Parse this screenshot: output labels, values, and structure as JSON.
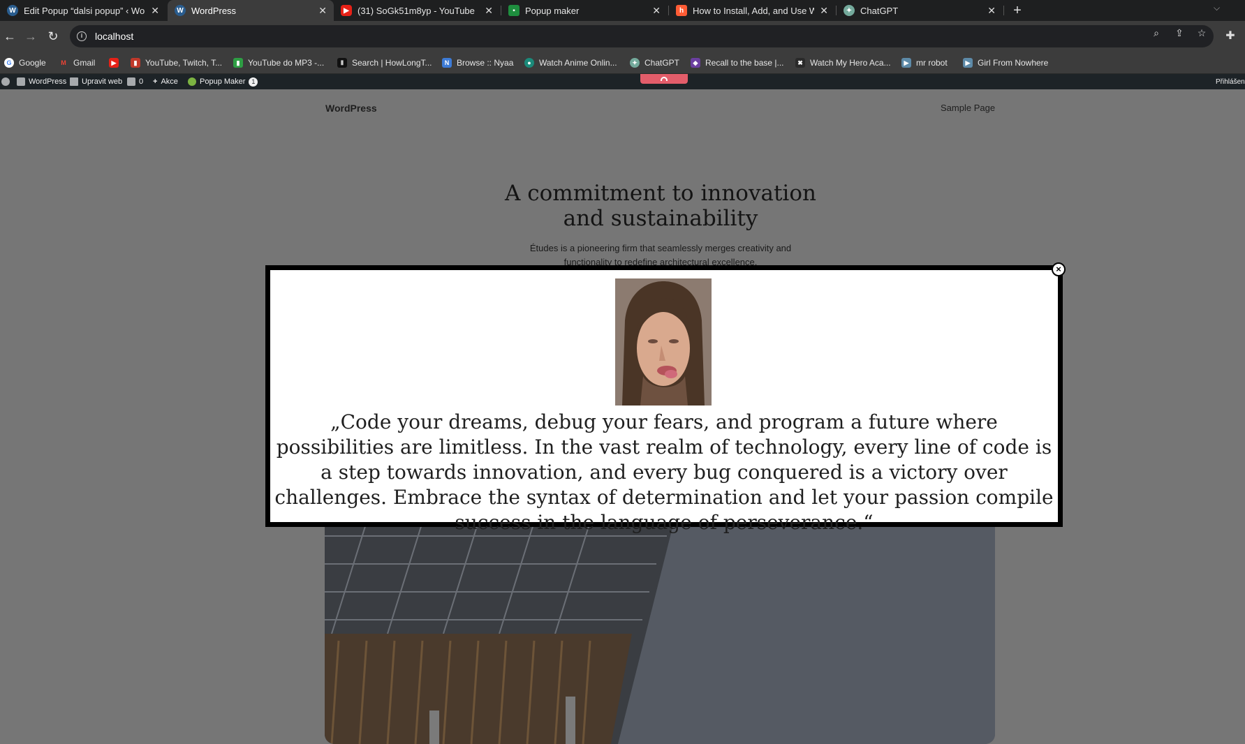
{
  "browser": {
    "tabs": [
      {
        "label": "Edit Popup “dalsi popup” ‹ Word",
        "icon": "wordpress-icon",
        "active": false
      },
      {
        "label": "WordPress",
        "icon": "wordpress-icon",
        "active": true
      },
      {
        "label": "(31) SoGk51m8yp - YouTube",
        "icon": "youtube-icon",
        "active": false
      },
      {
        "label": "Popup maker",
        "icon": "classroom-icon",
        "active": false
      },
      {
        "label": "How to Install, Add, and Use Wo",
        "icon": "hubspot-icon",
        "active": false
      },
      {
        "label": "ChatGPT",
        "icon": "chatgpt-icon",
        "active": false
      }
    ],
    "url": "localhost",
    "bookmarks": [
      {
        "label": "Google",
        "icon": "google-icon"
      },
      {
        "label": "Gmail",
        "icon": "gmail-icon"
      },
      {
        "label": "",
        "icon": "youtube-icon"
      },
      {
        "label": "YouTube, Twitch, T...",
        "icon": "chart-icon"
      },
      {
        "label": "YouTube do MP3 -...",
        "icon": "chart-icon"
      },
      {
        "label": "Search | HowLongT...",
        "icon": "hltb-icon"
      },
      {
        "label": "Browse :: Nyaa",
        "icon": "nyaa-icon"
      },
      {
        "label": "Watch Anime Onlin...",
        "icon": "anime-icon"
      },
      {
        "label": "ChatGPT",
        "icon": "chatgpt-icon"
      },
      {
        "label": "Recall to the base |...",
        "icon": "shield-icon"
      },
      {
        "label": "Watch My Hero Aca...",
        "icon": "anime-icon"
      },
      {
        "label": "mr robot",
        "icon": "media-icon"
      },
      {
        "label": "Girl From Nowhere",
        "icon": "media-icon"
      }
    ]
  },
  "adminbar": {
    "site": "WordPress",
    "customize": "Upravit web",
    "comments_count": "0",
    "new": "Akce",
    "popup_maker": "Popup Maker",
    "popup_badge": "1",
    "account": "Přihlášený"
  },
  "site": {
    "title": "WordPress",
    "nav_link": "Sample Page",
    "hero_title": "A commitment to innovation and sustainability",
    "hero_text": "Études is a pioneering firm that seamlessly merges creativity and functionality to redefine architectural excellence."
  },
  "popup": {
    "quote": "„Code your dreams, debug your fears, and program a future where possibilities are limitless. In the vast realm of technology, every line of code is a step towards innovation, and every bug conquered is a victory over challenges. Embrace the syntax of determination and let your passion compile success in the language of perseverance.“",
    "close_label": "×"
  },
  "colors": {
    "overlay": "#767676",
    "tab_bar": "#1e1f20",
    "toolbar": "#3c3c3c",
    "admin_bar": "#1d2327",
    "accent_red": "#e35d6a"
  }
}
